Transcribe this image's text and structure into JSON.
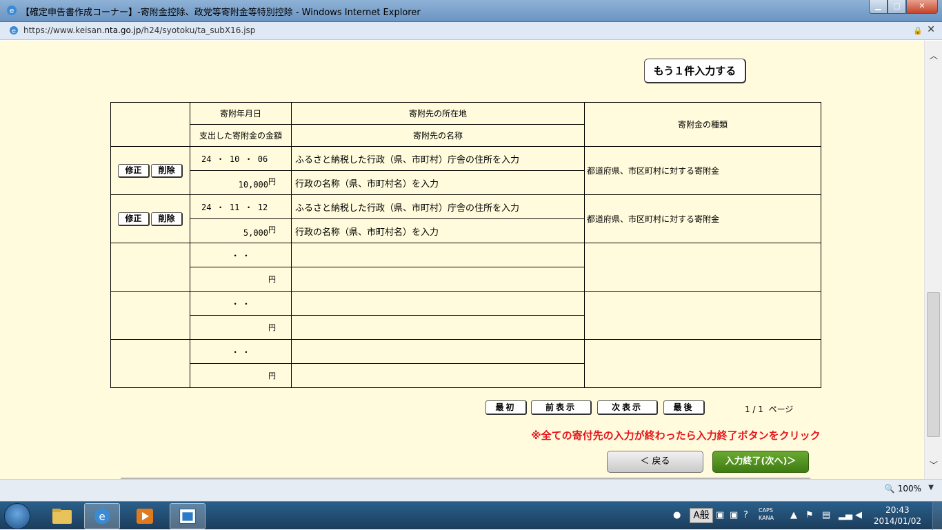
{
  "window": {
    "title": "【確定申告書作成コーナー】-寄附金控除、政党等寄附金等特別控除 - Windows Internet Explorer",
    "minimize": "▁",
    "maximize": "□",
    "close": "✕"
  },
  "address": {
    "url_prefix": "https://www.keisan.",
    "url_domain": "nta.go.jp",
    "url_path": "/h24/syotoku/ta_subX16.jsp"
  },
  "page": {
    "add_button": "もう１件入力する",
    "headers": {
      "date": "寄附年月日",
      "location": "寄附先の所在地",
      "kind": "寄附金の種類",
      "amount": "支出した寄附金の金額",
      "name": "寄附先の名称"
    },
    "edit_label": "修正",
    "delete_label": "削除",
    "rows": [
      {
        "date": "24 ・ 10 ・ 06",
        "location": "ふるさと納税した行政（県、市町村）庁舎の住所を入力",
        "amount": "10,000",
        "yen": "円",
        "name": "行政の名称（県、市町村名）を入力",
        "kind": "都道府県、市区町村に対する寄附金"
      },
      {
        "date": "24 ・ 11 ・ 12",
        "location": "ふるさと納税した行政（県、市町村）庁舎の住所を入力",
        "amount": "5,000",
        "yen": "円",
        "name": "行政の名称（県、市町村名）を入力",
        "kind": "都道府県、市区町村に対する寄附金"
      }
    ],
    "empty_date": "・    ・",
    "empty_yen": "円",
    "nav": {
      "first": "最初",
      "prev": "前表示",
      "next": "次表示",
      "last": "最後"
    },
    "page_info": "1 / 1  ページ",
    "notice": "※全ての寄付先の入力が終わったら入力終了ボタンをクリック",
    "back_button": "＜ 戻る",
    "finish_button": "入力終了(次へ)＞"
  },
  "status": {
    "zoom": "100%"
  },
  "taskbar": {
    "ime": "A般",
    "caps": "CAPS",
    "kana": "KANA",
    "time": "20:43",
    "date": "2014/01/02"
  }
}
